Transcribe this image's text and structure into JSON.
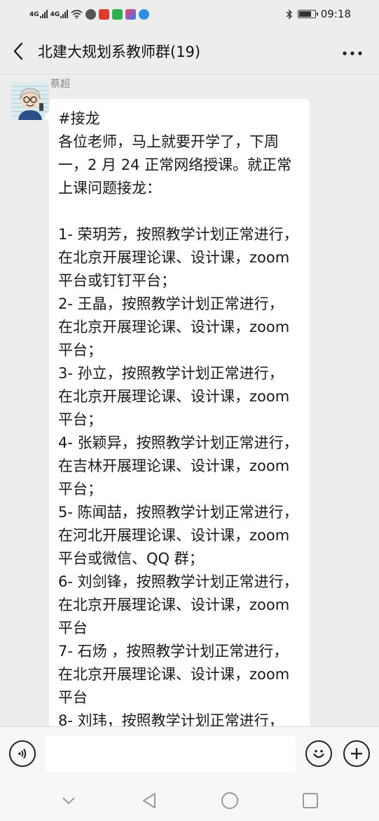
{
  "status_bar": {
    "signal_1": "4G",
    "signal_2": "4G",
    "time": "09:18"
  },
  "header": {
    "back_icon": "chevron-left-icon",
    "title": "北建大规划系教师群(19)",
    "more_icon": "more-dots-icon"
  },
  "message": {
    "sender": "蔡超",
    "lines": [
      "#接龙",
      "各位老师，马上就要开学了，下周",
      "一，2 月 24 正常网络授课。就正常",
      "上课问题接龙：",
      "",
      "1- 荣玥芳，按照教学计划正常进行，",
      "在北京开展理论课、设计课，zoom",
      "平台或钉钉平台；",
      "2- 王晶，按照教学计划正常进行，",
      "在北京开展理论课、设计课，zoom",
      "平台；",
      "3- 孙立，按照教学计划正常进行，",
      "在北京开展理论课、设计课，zoom",
      "平台；",
      "4- 张颖异，按照教学计划正常进行，",
      "在吉林开展理论课、设计课，zoom",
      "平台；",
      "5- 陈闻喆，按照教学计划正常进行，",
      "在河北开展理论课、设计课，zoom",
      "平台或微信、QQ 群；",
      "6- 刘剑锋，按照教学计划正常进行，",
      "在北京开展理论课、设计课，zoom",
      "平台",
      "7- 石炀 ，按照教学计划正常进行，",
      "在北京开展理论课、设计课，zoom",
      "平台",
      "8- 刘玮，按照教学计划正常进行，"
    ]
  },
  "input_bar": {
    "voice_icon": "voice-icon",
    "emoji_icon": "emoji-icon",
    "plus_icon": "plus-icon",
    "input_value": ""
  },
  "nav_bar": {
    "icons": [
      "collapse-chevron-icon",
      "back-triangle-icon",
      "home-circle-icon",
      "recents-square-icon"
    ]
  },
  "colors": {
    "background": "#ededed",
    "bubble": "#ffffff"
  }
}
